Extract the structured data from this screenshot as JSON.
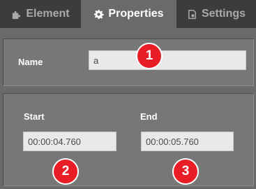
{
  "tabs": [
    {
      "label": "Element",
      "icon": "puzzle-icon"
    },
    {
      "label": "Properties",
      "icon": "gear-icon",
      "active": true
    },
    {
      "label": "Settings",
      "icon": "settings-doc-icon"
    }
  ],
  "name_panel": {
    "label": "Name",
    "value": "a"
  },
  "time_panel": {
    "start_label": "Start",
    "start_value": "00:00:04.760",
    "end_label": "End",
    "end_value": "00:00:05.760"
  },
  "callouts": [
    "1",
    "2",
    "3"
  ],
  "colors": {
    "tabbar": "#3c3c3c",
    "active_tab": "#6a6a6a",
    "panel": "#777777",
    "input": "#e9e9e9",
    "callout": "#e81d25"
  }
}
